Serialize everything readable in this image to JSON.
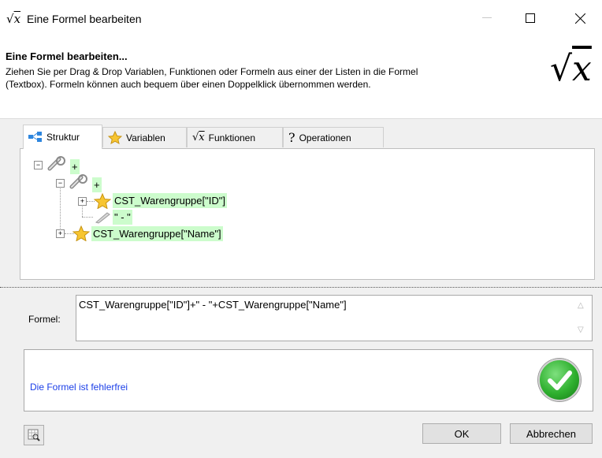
{
  "window": {
    "title": "Eine Formel bearbeiten",
    "icon": "sqrt-x-icon"
  },
  "header": {
    "title": "Eine Formel bearbeiten...",
    "description_line1": "Ziehen Sie per Drag & Drop Variablen, Funktionen oder Formeln aus einer der Listen in die Formel",
    "description_line2": "(Textbox). Formeln können auch bequem über einen Doppelklick übernommen werden."
  },
  "tabs": [
    {
      "label": "Struktur",
      "icon": "tree-structure-icon",
      "active": true
    },
    {
      "label": "Variablen",
      "icon": "star-icon"
    },
    {
      "label": "Funktionen",
      "icon": "sqrt-x-icon"
    },
    {
      "label": "Operationen",
      "icon": "question-icon"
    }
  ],
  "tree": {
    "root": "+",
    "child": "+",
    "leaf1": "CST_Warengruppe[\"ID\"]",
    "leaf2": "\" - \"",
    "leaf3": "CST_Warengruppe[\"Name\"]"
  },
  "formula": {
    "label": "Formel:",
    "value": "CST_Warengruppe[\"ID\"]+\" - \"+CST_Warengruppe[\"Name\"]"
  },
  "status": {
    "text": "Die Formel ist fehlerfrei",
    "icon": "check-icon"
  },
  "buttons": {
    "ok": "OK",
    "cancel": "Abbrechen"
  },
  "colors": {
    "node_highlight": "#ccfccc",
    "status_text": "#1a3ee8",
    "check": "#2fb02f"
  }
}
